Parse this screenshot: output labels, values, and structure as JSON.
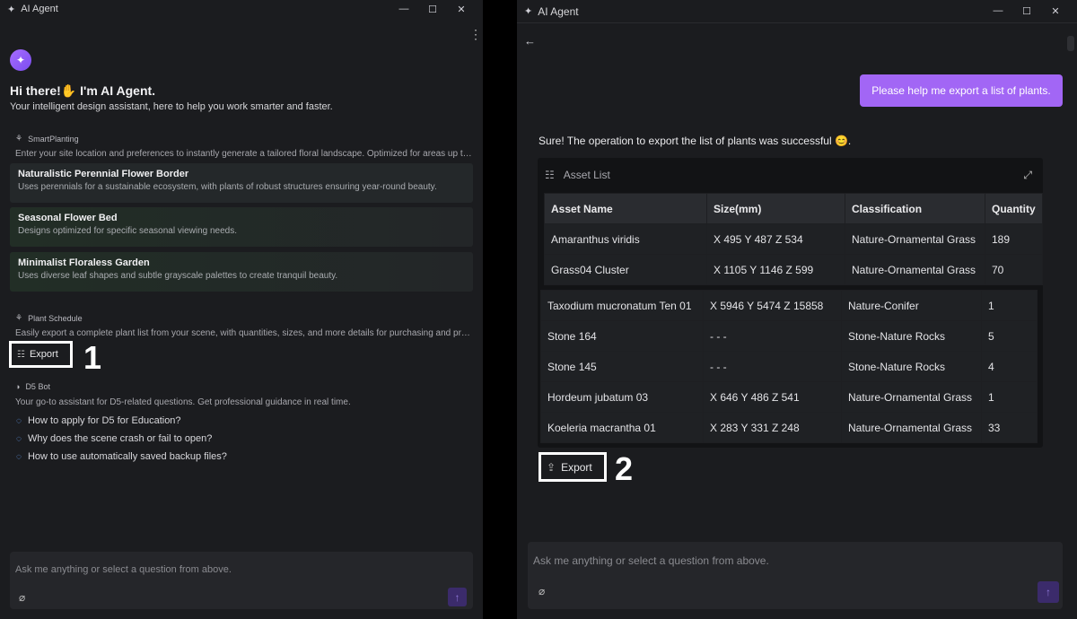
{
  "left": {
    "window_title": "AI Agent",
    "greeting": "Hi there!✋ I'm AI Agent.",
    "subtitle": "Your intelligent design assistant, here to help you work smarter and faster.",
    "smart_planting": {
      "title": "SmartPlanting",
      "description": "Enter your site location and preferences to instantly generate a tailored floral landscape. Optimized for areas up to ...",
      "cards": [
        {
          "title": "Naturalistic Perennial Flower Border",
          "desc": "Uses perennials for a sustainable ecosystem, with plants of robust structures ensuring year-round beauty."
        },
        {
          "title": "Seasonal Flower Bed",
          "desc": "Designs optimized for specific seasonal viewing needs."
        },
        {
          "title": "Minimalist Floraless Garden",
          "desc": "Uses diverse leaf shapes and subtle grayscale palettes to create tranquil beauty."
        }
      ]
    },
    "plant_schedule": {
      "title": "Plant Schedule",
      "description": "Easily export a complete plant list from your scene, with quantities, sizes, and more details for purchasing and proj...",
      "export_label": "Export"
    },
    "annotation_1": "1",
    "d5_bot": {
      "title": "D5 Bot",
      "description": "Your go-to assistant for D5-related questions. Get professional guidance in real time.",
      "questions": [
        "How to apply for D5 for Education?",
        "Why does the scene crash or fail to open?",
        "How to use automatically saved backup files?"
      ]
    },
    "input_placeholder": "Ask me anything or select a question from above."
  },
  "right": {
    "window_title": "AI Agent",
    "user_message": "Please help me export a list of plants.",
    "reply": "Sure! The operation to export the list of plants was successful 😊.",
    "asset_list": {
      "title": "Asset List",
      "headers": [
        "Asset Name",
        "Size(mm)",
        "Classification",
        "Quantity"
      ],
      "rows_top": [
        [
          "Amaranthus viridis",
          "X 495 Y 487 Z 534",
          "Nature-Ornamental Grass",
          "189"
        ],
        [
          "Grass04 Cluster",
          "X 1105 Y 1146 Z 599",
          "Nature-Ornamental Grass",
          "70"
        ]
      ],
      "rows_bottom": [
        [
          "Taxodium mucronatum Ten 01",
          "X 5946 Y 5474 Z 15858",
          "Nature-Conifer",
          "1"
        ],
        [
          "Stone 164",
          "- - -",
          "Stone-Nature Rocks",
          "5"
        ],
        [
          "Stone 145",
          "- - -",
          "Stone-Nature Rocks",
          "4"
        ],
        [
          "Hordeum jubatum 03",
          "X 646 Y 486 Z 541",
          "Nature-Ornamental Grass",
          "1"
        ],
        [
          "Koeleria macrantha 01",
          "X 283 Y 331 Z 248",
          "Nature-Ornamental Grass",
          "33"
        ]
      ]
    },
    "export_label": "Export",
    "annotation_2": "2",
    "input_placeholder": "Ask me anything or select a question from above."
  }
}
